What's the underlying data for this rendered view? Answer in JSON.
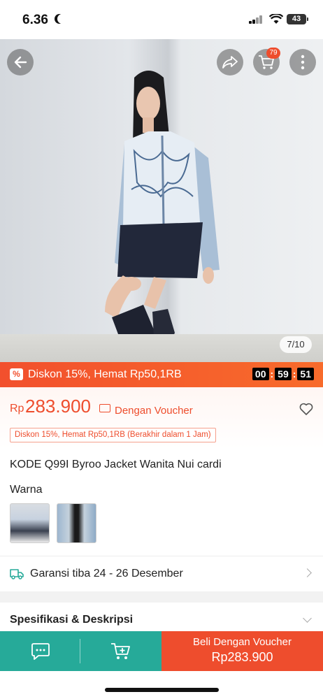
{
  "status_bar": {
    "time": "6.36",
    "battery": "43"
  },
  "photo": {
    "counter": "7/10",
    "cart_count": "79"
  },
  "flash": {
    "text": "Diskon 15%, Hemat Rp50,1RB",
    "timer": {
      "hours": "00",
      "minutes": "59",
      "seconds": "51"
    }
  },
  "price": {
    "currency": "Rp",
    "value": "283.900",
    "voucher_text": "Dengan Voucher",
    "discount_chip": "Diskon 15%, Hemat Rp50,1RB (Berakhir dalam 1 Jam)"
  },
  "product": {
    "title": "KODE Q99I Byroo  Jacket Wanita Nui cardi",
    "color_label": "Warna"
  },
  "shipping": {
    "text": "Garansi tiba 24 - 26 Desember"
  },
  "spec": {
    "label": "Spesifikasi & Deskripsi"
  },
  "bottom": {
    "buy_line1": "Beli Dengan Voucher",
    "buy_line2": "Rp283.900"
  },
  "colors": {
    "accent": "#ee4d2d",
    "teal": "#26aa99"
  }
}
